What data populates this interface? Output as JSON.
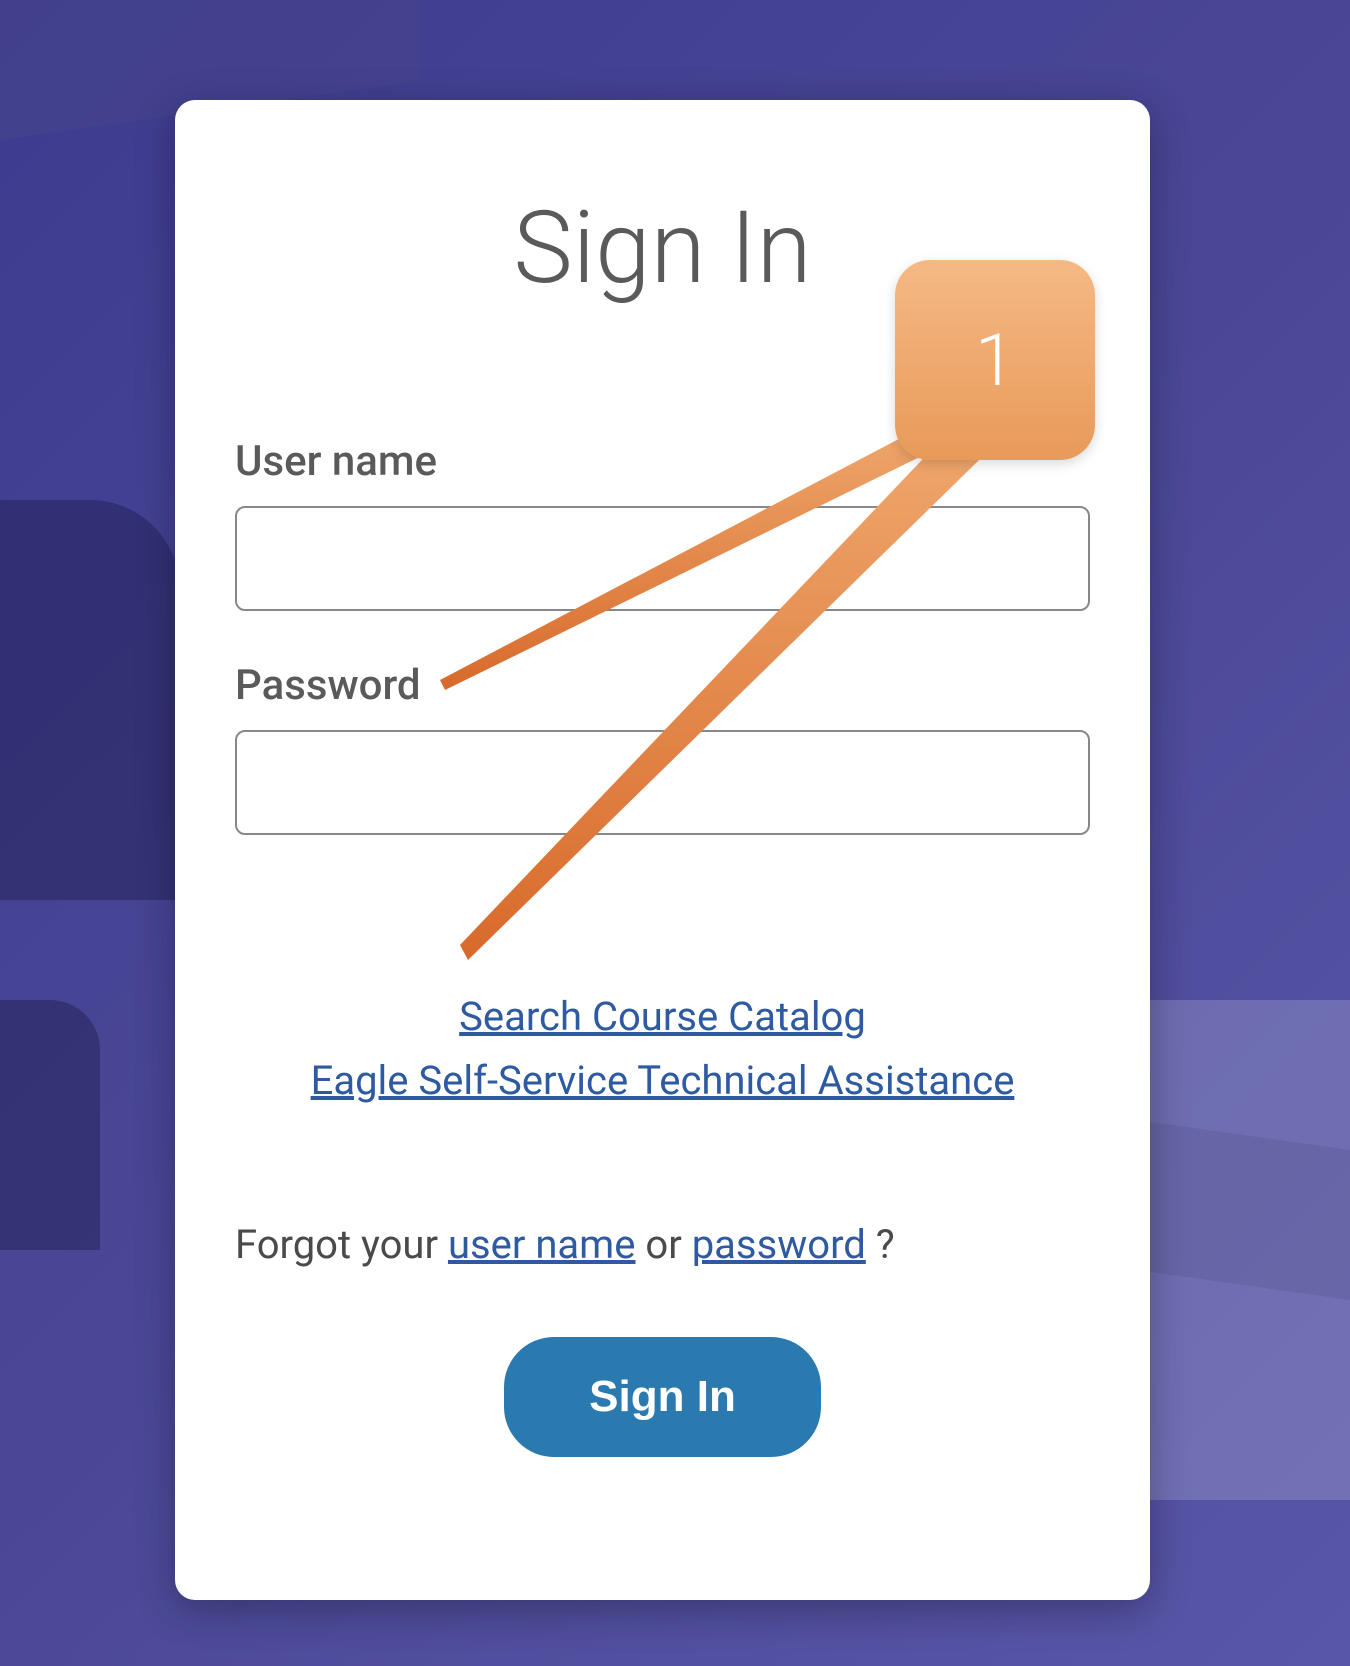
{
  "title": "Sign In",
  "form": {
    "username_label": "User name",
    "username_value": "",
    "password_label": "Password",
    "password_value": ""
  },
  "links": {
    "catalog": "Search Course Catalog",
    "assistance": "Eagle Self-Service Technical Assistance"
  },
  "forgot": {
    "prefix": "Forgot your ",
    "username_link": "user name",
    "mid": " or ",
    "password_link": "password",
    "suffix": " ?"
  },
  "button": {
    "signin_label": "Sign In"
  },
  "annotation": {
    "number": "1"
  }
}
